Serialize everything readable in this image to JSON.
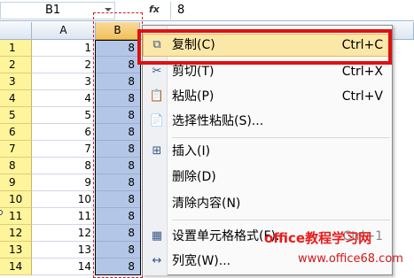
{
  "formula_bar": {
    "name_box": "B1",
    "fx_symbol": "fx",
    "formula_value": "8"
  },
  "columns": {
    "a": "A",
    "b": "B"
  },
  "rows": [
    {
      "num": "1",
      "a": "1",
      "b": "8"
    },
    {
      "num": "2",
      "a": "2",
      "b": "8"
    },
    {
      "num": "3",
      "a": "3",
      "b": "8"
    },
    {
      "num": "4",
      "a": "4",
      "b": "8"
    },
    {
      "num": "5",
      "a": "5",
      "b": "8"
    },
    {
      "num": "6",
      "a": "6",
      "b": "8"
    },
    {
      "num": "7",
      "a": "7",
      "b": "8"
    },
    {
      "num": "8",
      "a": "8",
      "b": "8"
    },
    {
      "num": "9",
      "a": "9",
      "b": "8"
    },
    {
      "num": "10",
      "a": "10",
      "b": "8"
    },
    {
      "num": "11",
      "a": "11",
      "b": "8"
    },
    {
      "num": "12",
      "a": "12",
      "b": "8"
    },
    {
      "num": "13",
      "a": "13",
      "b": "8"
    },
    {
      "num": "14",
      "a": "14",
      "b": "8"
    }
  ],
  "context_menu": {
    "copy": {
      "label": "复制(C)",
      "shortcut": "Ctrl+C",
      "icon": "copy-icon"
    },
    "cut": {
      "label": "剪切(T)",
      "shortcut": "Ctrl+X",
      "icon": "scissors-icon"
    },
    "paste": {
      "label": "粘贴(P)",
      "shortcut": "Ctrl+V",
      "icon": "paste-icon"
    },
    "paste_special": {
      "label": "选择性粘贴(S)...",
      "icon": "paste-special-icon"
    },
    "insert": {
      "label": "插入(I)",
      "icon": "insert-icon"
    },
    "delete": {
      "label": "删除(D)"
    },
    "clear": {
      "label": "清除内容(N)"
    },
    "format_cells": {
      "label": "设置单元格格式(F)...",
      "shortcut": "Ctrl+1",
      "icon": "format-cells-icon"
    },
    "col_width": {
      "label": "列宽(W)...",
      "icon": "column-width-icon"
    }
  },
  "watermark": {
    "logo": "office教程学习网",
    "url": "www.office68.com"
  },
  "colors": {
    "highlight_border": "#e01010",
    "selected_column": "#b4c6e7",
    "row_header": "#fdf49b"
  }
}
